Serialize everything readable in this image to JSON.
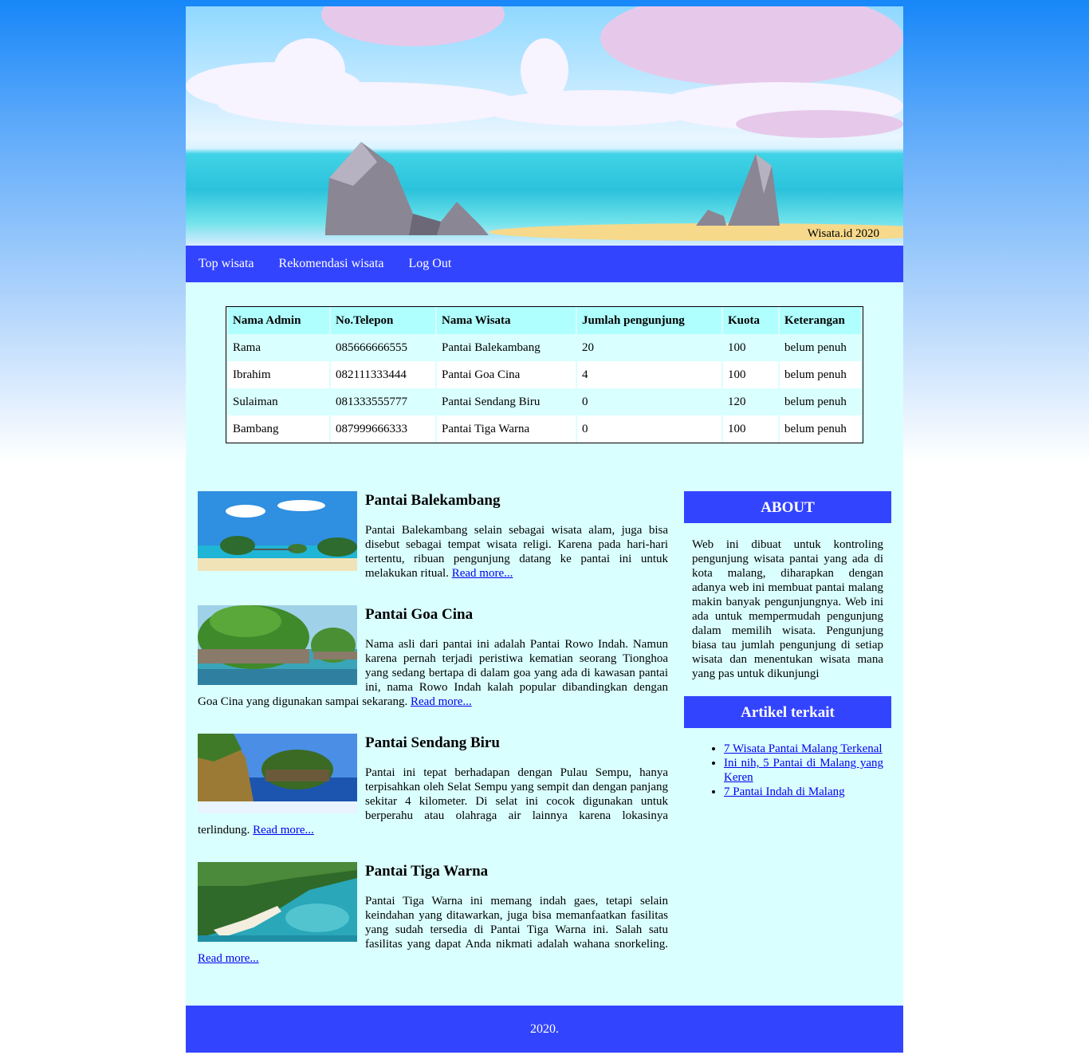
{
  "header": {
    "caption": "Wisata.id 2020"
  },
  "nav": {
    "items": [
      {
        "label": "Top wisata"
      },
      {
        "label": "Rekomendasi wisata"
      },
      {
        "label": "Log Out"
      }
    ]
  },
  "admin_table": {
    "headers": [
      "Nama Admin",
      "No.Telepon",
      "Nama Wisata",
      "Jumlah pengunjung",
      "Kuota",
      "Keterangan"
    ],
    "rows": [
      [
        "Rama",
        "085666666555",
        "Pantai Balekambang",
        "20",
        "100",
        "belum penuh"
      ],
      [
        "Ibrahim",
        "082111333444",
        "Pantai Goa Cina",
        "4",
        "100",
        "belum penuh"
      ],
      [
        "Sulaiman",
        "081333555777",
        "Pantai Sendang Biru",
        "0",
        "120",
        "belum penuh"
      ],
      [
        "Bambang",
        "087999666333",
        "Pantai Tiga Warna",
        "0",
        "100",
        "belum penuh"
      ]
    ]
  },
  "articles": [
    {
      "title": "Pantai Balekambang",
      "body": "Pantai Balekambang selain sebagai wisata alam, juga bisa disebut sebagai tempat wisata religi. Karena pada hari-hari tertentu, ribuan pengunjung datang ke pantai ini untuk melakukan ritual. ",
      "link": "Read more..."
    },
    {
      "title": "Pantai Goa Cina",
      "body": "Nama asli dari pantai ini adalah Pantai Rowo Indah. Namun karena pernah terjadi peristiwa kematian seorang Tionghoa yang sedang bertapa di dalam goa yang ada di kawasan pantai ini, nama Rowo Indah kalah popular dibandingkan dengan Goa Cina yang digunakan sampai sekarang. ",
      "link": "Read more..."
    },
    {
      "title": "Pantai Sendang Biru",
      "body": "Pantai ini tepat berhadapan dengan Pulau Sempu, hanya terpisahkan oleh Selat Sempu yang sempit dan dengan panjang sekitar 4 kilometer. Di selat ini cocok digunakan untuk berperahu atau olahraga air lainnya karena lokasinya terlindung. ",
      "link": "Read more..."
    },
    {
      "title": "Pantai Tiga Warna",
      "body": "Pantai Tiga Warna ini memang indah gaes, tetapi selain keindahan yang ditawarkan, juga bisa memanfaatkan fasilitas yang sudah tersedia di Pantai Tiga Warna ini. Salah satu fasilitas yang dapat Anda nikmati adalah wahana snorkeling. ",
      "link": "Read more..."
    }
  ],
  "sidebar": {
    "about_title": "ABOUT",
    "about_text": "Web ini dibuat untuk kontroling pengunjung wisata pantai yang ada di kota malang, diharapkan dengan adanya web ini membuat pantai malang makin banyak pengunjungnya. Web ini ada untuk mempermudah pengunjung dalam memilih wisata. Pengunjung biasa tau jumlah pengunjung di setiap wisata dan menentukan wisata mana yang pas untuk dikunjungi",
    "related_title": "Artikel terkait",
    "related_links": [
      "7 Wisata Pantai Malang Terkenal",
      "Ini nih, 5 Pantai di Malang yang Keren",
      "7 Pantai Indah di Malang"
    ]
  },
  "footer": {
    "text": "2020."
  }
}
